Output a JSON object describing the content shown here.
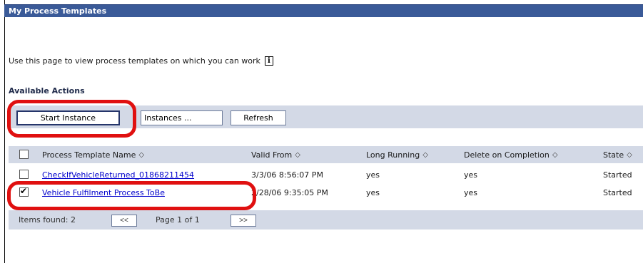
{
  "panel": {
    "title": "My Process Templates"
  },
  "description": "Use this page to view process templates on which you can work",
  "actions": {
    "title": "Available Actions",
    "start_instance": "Start Instance",
    "instances": "Instances ...",
    "refresh": "Refresh"
  },
  "table": {
    "columns": [
      "Process Template Name",
      "Valid From",
      "Long Running",
      "Delete on Completion",
      "State"
    ],
    "rows": [
      {
        "name": "CheckIfVehicleReturned_01868211454",
        "valid_from": "3/3/06 8:56:07 PM",
        "long_running": "yes",
        "delete_on_completion": "yes",
        "state": "Started",
        "checked": false
      },
      {
        "name": "Vehicle Fulfilment Process ToBe",
        "valid_from": "2/28/06 9:35:05 PM",
        "long_running": "yes",
        "delete_on_completion": "yes",
        "state": "Started",
        "checked": true
      }
    ]
  },
  "pager": {
    "items_found": "Items found: 2",
    "prev": "<<",
    "page": "Page 1 of 1",
    "next": ">>"
  },
  "icons": {
    "info": "info-icon",
    "sort": "sort-icon"
  },
  "colors": {
    "titlebar": "#3a5a98",
    "bar": "#d3d9e6",
    "highlight": "#e01010",
    "link": "#0000cc"
  }
}
